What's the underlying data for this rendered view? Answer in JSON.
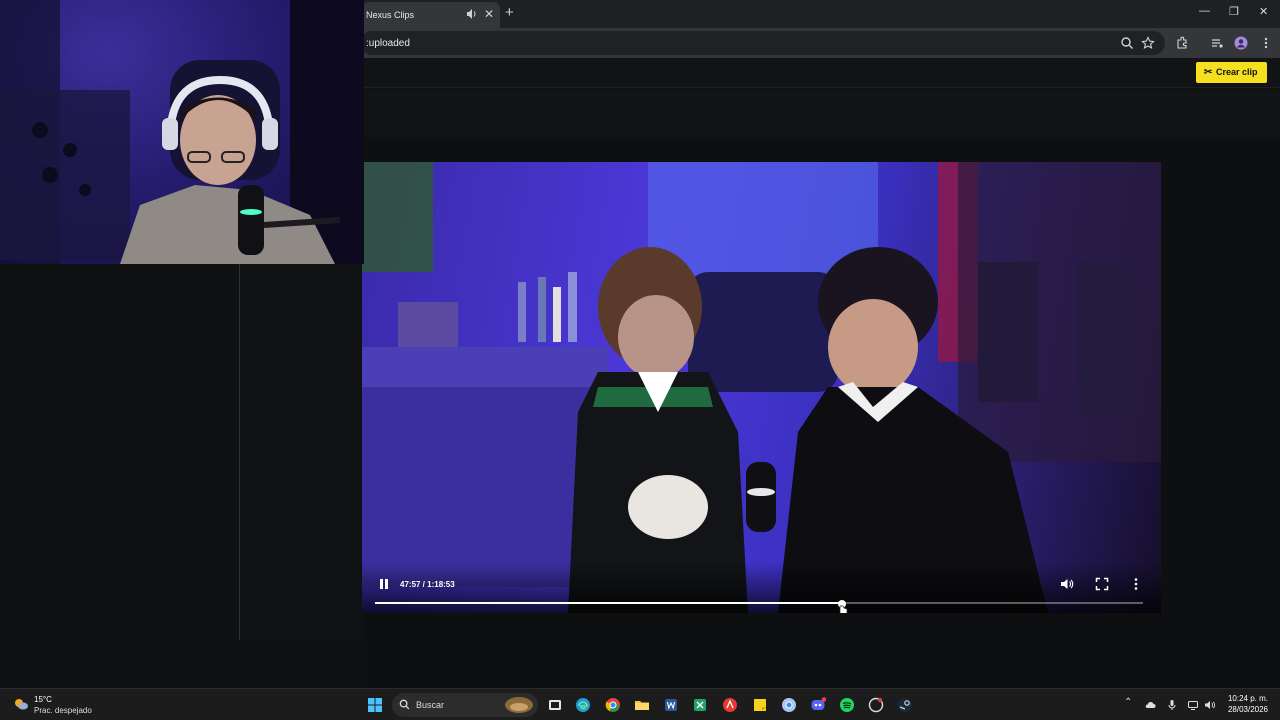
{
  "browser": {
    "tab_title": "Nexus Clips",
    "url": ":uploaded"
  },
  "page": {
    "create_clip_label": "Crear clip",
    "accent_color": "#f5e020"
  },
  "player": {
    "time": "47:57 / 1:18:53",
    "progress": 0.608
  },
  "taskbar": {
    "temperature": "15°C",
    "weather": "Prac. despejado",
    "search_label": "Buscar",
    "time": "10:24 p. m.",
    "date": "28/03/2026"
  }
}
